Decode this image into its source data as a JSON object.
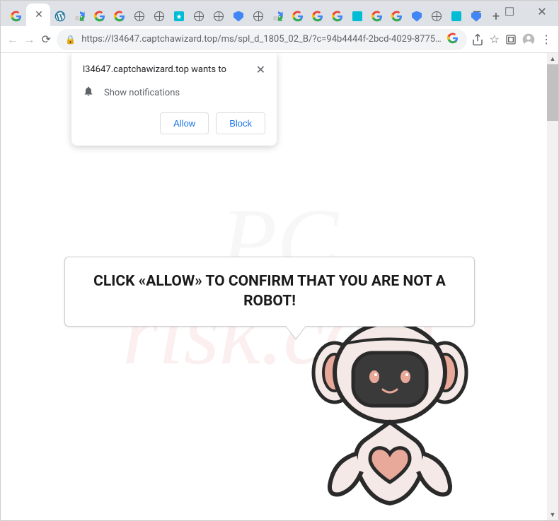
{
  "window": {
    "controls": {
      "min": "—",
      "max": "☐",
      "close": "✕"
    }
  },
  "tabs": {
    "new_tab": "+"
  },
  "toolbar": {
    "nav_back": "←",
    "nav_forward": "→",
    "reload": "⟳",
    "url": "https://l34647.captchawizard.top/ms/spl_d_1805_02_B/?c=94b4444f-2bcd-4029-8775…",
    "share": "⇪",
    "star": "☆",
    "menu": "⋮"
  },
  "permission": {
    "title": "l34647.captchawizard.top wants to",
    "row_label": "Show notifications",
    "allow": "Allow",
    "block": "Block"
  },
  "page": {
    "speech_text": "CLICK «ALLOW» TO CONFIRM THAT YOU ARE NOT A ROBOT!"
  },
  "watermark": {
    "line1": "PC",
    "line2": "risk.com"
  }
}
